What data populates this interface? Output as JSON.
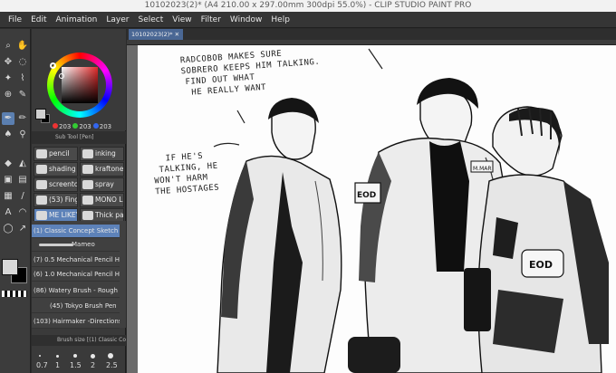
{
  "window": {
    "title": "10102023(2)* (A4 210.00 x 297.00mm 300dpi 55.0%) - CLIP STUDIO PAINT PRO"
  },
  "menu": [
    "File",
    "Edit",
    "Animation",
    "Layer",
    "Select",
    "View",
    "Filter",
    "Window",
    "Help"
  ],
  "color": {
    "r": "203",
    "g": "203",
    "b": "203"
  },
  "subtool_panel": {
    "title": "Sub Tool [Pen]"
  },
  "subtools": [
    {
      "label": "pencil",
      "selected": false
    },
    {
      "label": "inking",
      "selected": false
    },
    {
      "label": "shading",
      "selected": false
    },
    {
      "label": "kraftone",
      "selected": false
    },
    {
      "label": "screenton",
      "selected": false
    },
    {
      "label": "spray",
      "selected": false
    },
    {
      "label": "(53) Fing",
      "selected": false
    },
    {
      "label": "MONO LI",
      "selected": false
    },
    {
      "label": "ME LIKEY",
      "selected": true
    },
    {
      "label": "Thick pa",
      "selected": false
    }
  ],
  "brushes": [
    "(1) Classic Concept Sketch",
    "Mameo",
    "(7) 0.5 Mechanical Pencil H",
    "(6) 1.0 Mechanical Pencil H",
    "(86) Watery Brush - Rough",
    "(45) Tokyo Brush Pen",
    "(103) Hairmaker -Directions"
  ],
  "brush_size": {
    "title": "Brush size [(1) Classic Conce",
    "values": [
      "0.7",
      "1",
      "1.5",
      "2",
      "2.5"
    ]
  },
  "document": {
    "tab": "10102023(2)*"
  },
  "speech": {
    "top": [
      "RADCOBOB MAKES SURE",
      "SOBRERO KEEPS HIM TALKING.",
      "FIND OUT WHAT",
      "HE REALLY WANT"
    ],
    "left": [
      "IF HE'S",
      "TALKING, HE",
      "WON'T HARM",
      "THE HOSTAGES"
    ]
  },
  "patches": {
    "badge1": "EOD",
    "badge2": "EOD",
    "nametag": "M.MAR"
  },
  "colors": {
    "accent": "#5d82b9",
    "panel": "#3a3a3a",
    "canvas": "#fdfdfd"
  },
  "icons": [
    "pen-icon",
    "eraser-icon",
    "lasso-icon",
    "eyedropper-icon",
    "fill-icon",
    "text-icon",
    "gradient-icon",
    "shape-icon"
  ]
}
